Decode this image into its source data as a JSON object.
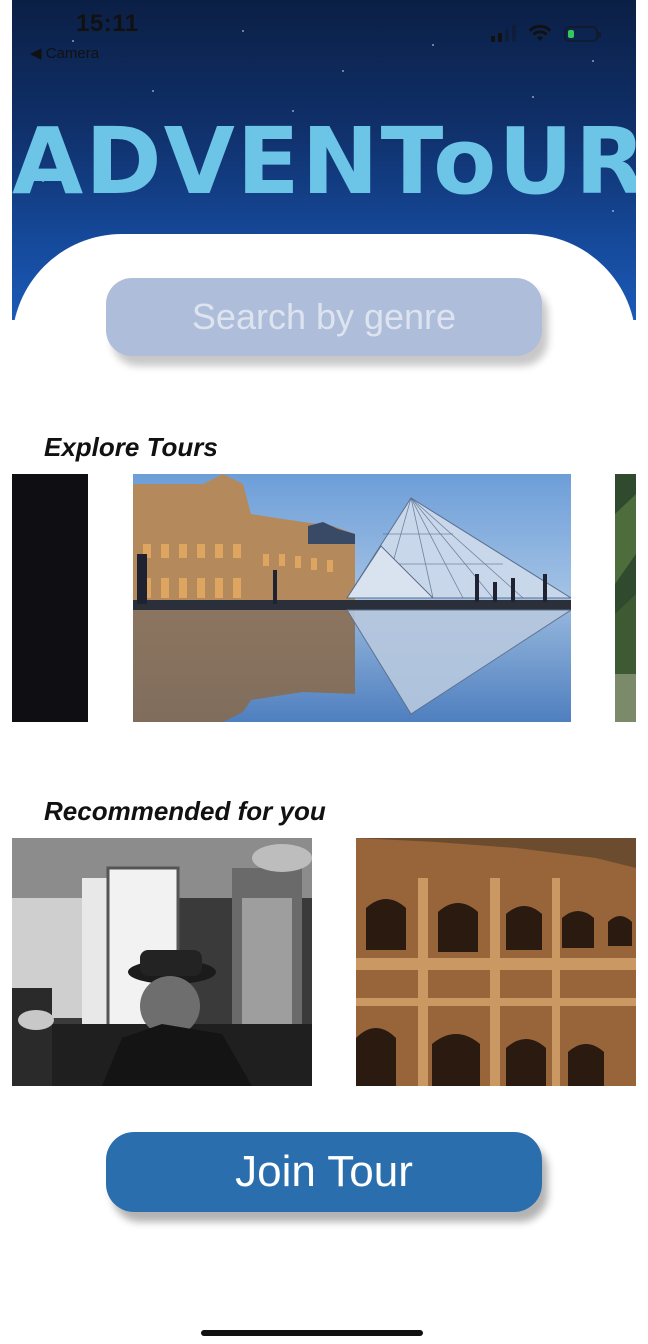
{
  "status_bar": {
    "time": "15:11",
    "back_label": "◀ Camera"
  },
  "header": {
    "logo_text": "ADVENToUR"
  },
  "search": {
    "placeholder": "Search by genre"
  },
  "sections": {
    "explore_title": "Explore Tours",
    "recommended_title": "Recommended for you"
  },
  "actions": {
    "join_label": "Join Tour"
  },
  "colors": {
    "logo": "#6cc4e6",
    "header_top": "#0b1f45",
    "search_bg": "#aebdd9",
    "join_bg": "#2b6ead"
  },
  "icons": [
    "signal-icon",
    "wifi-icon",
    "battery-icon"
  ]
}
